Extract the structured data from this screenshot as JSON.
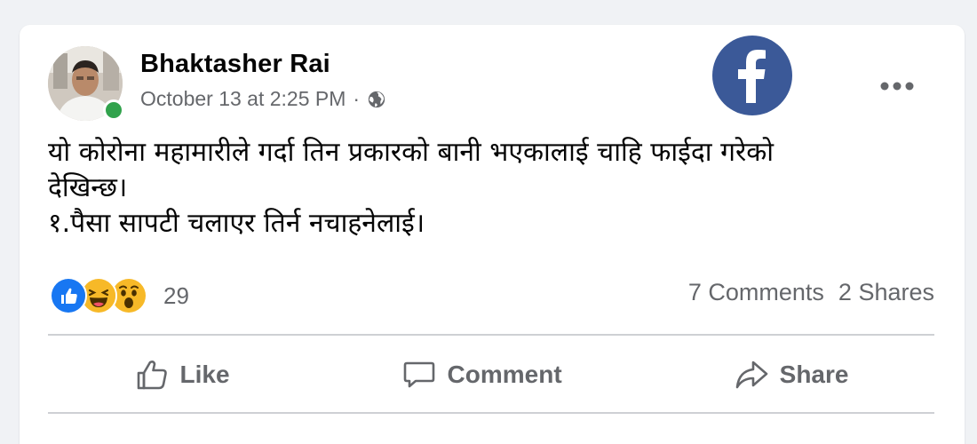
{
  "post": {
    "author": "Bhaktasher Rai",
    "timestamp": "October 13 at 2:25 PM",
    "separator": "·",
    "privacy_icon": "globe-icon",
    "brand_icon": "facebook-logo",
    "brand_color": "#3b5998",
    "more_icon": "more-options-icon",
    "text_lines": [
      "यो कोरोना महामारीले गर्दा तिन प्रकारको बानी भएकालाई चाहि फाईदा गरेको",
      "देखिन्छ।",
      "१.पैसा सापटी चलाएर तिर्न नचाहनेलाई।"
    ]
  },
  "reactions": {
    "icons": [
      "like-reaction-icon",
      "haha-reaction-icon",
      "wow-reaction-icon"
    ],
    "count": "29",
    "comments": "7 Comments",
    "shares": "2 Shares"
  },
  "actions": {
    "like": "Like",
    "comment": "Comment",
    "share": "Share"
  },
  "colors": {
    "background": "#f0f2f5",
    "online": "#31a24c",
    "secondary_text": "#65676b",
    "like_blue": "#1877f2",
    "reaction_yellow": "#f7b928"
  }
}
